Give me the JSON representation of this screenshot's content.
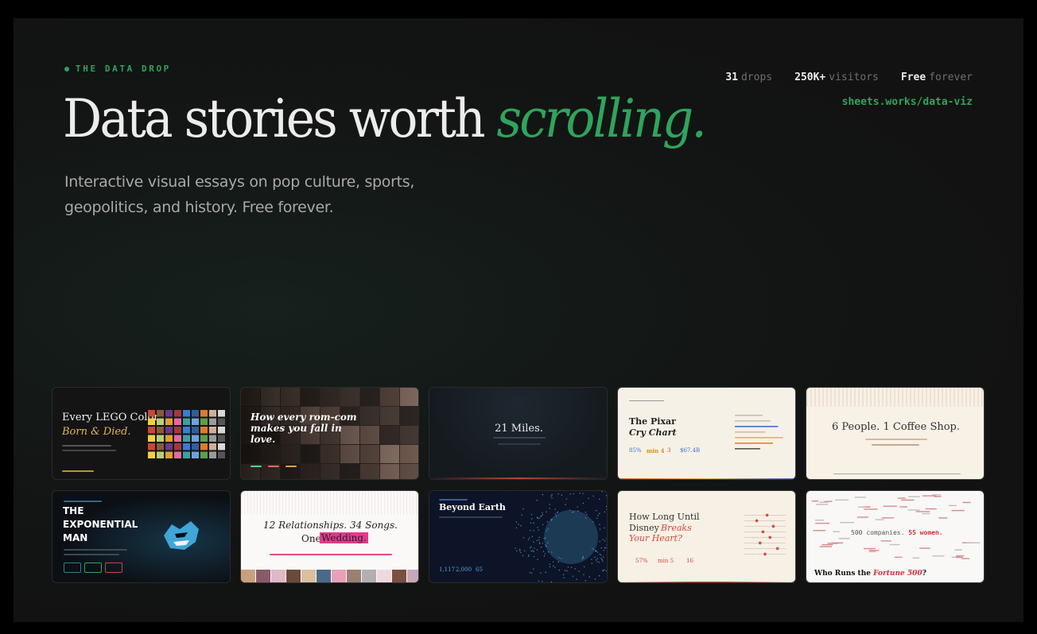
{
  "brand": {
    "label": "THE DATA DROP",
    "accent": "#2ea35d"
  },
  "headline": {
    "main": "Data stories worth ",
    "accent": "scrolling."
  },
  "subtitle": "Interactive visual essays on pop culture, sports, geopolitics, and history. Free forever.",
  "stats": [
    {
      "value": "31",
      "label": "drops"
    },
    {
      "value": "250K+",
      "label": "visitors"
    },
    {
      "value": "Free",
      "label": "forever"
    }
  ],
  "site_link": "sheets.works/data-viz",
  "cards": [
    {
      "id": "lego",
      "title_1": "Every LEGO Color,",
      "title_2": "Born & Died."
    },
    {
      "id": "romcom",
      "title_1": "How every rom-com",
      "title_2": "makes you fall in",
      "title_3": "love."
    },
    {
      "id": "miles",
      "title_1": "21 Miles."
    },
    {
      "id": "pixar",
      "title_1": "The Pixar",
      "title_2": "Cry Chart",
      "stat_1": "85%",
      "stat_2": "min 4",
      "stat_3": "3",
      "stat_4": "$67.4B"
    },
    {
      "id": "coffee",
      "title_1": "6 People. 1 Coffee Shop."
    },
    {
      "id": "mrbeast",
      "title_1": "THE",
      "title_2": "EXPONENTIAL",
      "title_3": "MAN"
    },
    {
      "id": "swift",
      "title_1": "12 Relationships. 34 Songs.",
      "title_2": "One ",
      "title_3": "Wedding."
    },
    {
      "id": "earth",
      "title_1": "Beyond Earth",
      "stat_1": "1,117",
      "stat_2": "2,000",
      "stat_3": "65"
    },
    {
      "id": "disney",
      "title_1": "How Long Until",
      "title_2": "Disney ",
      "title_3": "Breaks",
      "title_4": "Your Heart?",
      "stat_1": "57%",
      "stat_2": "min 5",
      "stat_3": "16"
    },
    {
      "id": "fortune",
      "center": "500 companies. ",
      "center_accent": "55 women.",
      "title_1": "Who Runs the ",
      "title_2": "Fortune 500",
      "title_3": "?"
    }
  ]
}
